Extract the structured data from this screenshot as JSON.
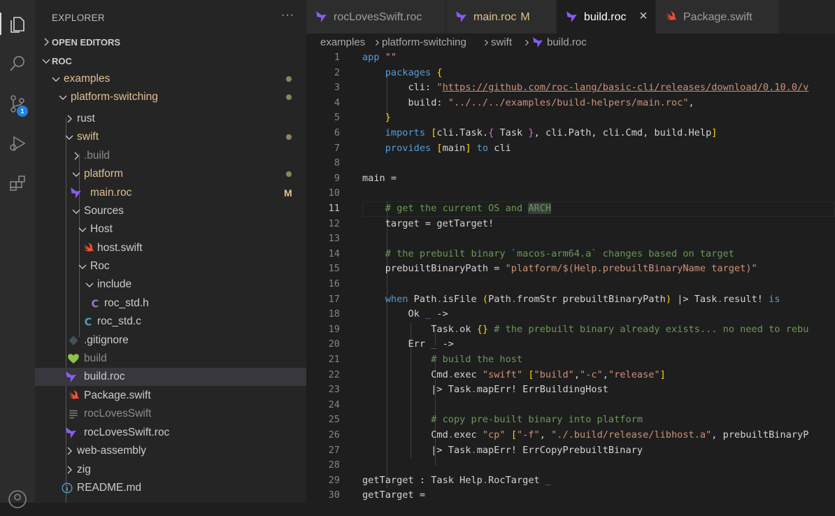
{
  "sidebar": {
    "title": "EXPLORER",
    "more": "···",
    "open_editors": "OPEN EDITORS",
    "root": "ROC",
    "tree": [
      {
        "label": "examples",
        "icon": "chevron-down",
        "status": "dot",
        "color": "#e2c08d"
      },
      {
        "label": "platform-switching",
        "icon": "chevron-down",
        "status": "dot",
        "color": "#e2c08d"
      },
      {
        "label": "rust",
        "icon": "chevron-right",
        "color": "#cccccc"
      },
      {
        "label": "swift",
        "icon": "chevron-down",
        "status": "dot",
        "color": "#e2c08d"
      },
      {
        "label": ".build",
        "icon": "chevron-right",
        "color": "#8c8c8c"
      },
      {
        "label": "platform",
        "icon": "chevron-down",
        "status": "dot",
        "color": "#e2c08d"
      },
      {
        "label": "main.roc",
        "icon": "roc-file-icon",
        "status": "M",
        "color": "#e2c08d"
      },
      {
        "label": "Sources",
        "icon": "chevron-down",
        "color": "#cccccc"
      },
      {
        "label": "Host",
        "icon": "chevron-down",
        "color": "#cccccc"
      },
      {
        "label": "host.swift",
        "icon": "swift-file-icon",
        "color": "#cccccc"
      },
      {
        "label": "Roc",
        "icon": "chevron-down",
        "color": "#cccccc"
      },
      {
        "label": "include",
        "icon": "chevron-down",
        "color": "#cccccc"
      },
      {
        "label": "roc_std.h",
        "icon": "c-header-icon",
        "color": "#cccccc"
      },
      {
        "label": "roc_std.c",
        "icon": "c-file-icon",
        "color": "#cccccc"
      },
      {
        "label": ".gitignore",
        "icon": "git-icon",
        "color": "#cccccc"
      },
      {
        "label": "build",
        "icon": "heart-icon",
        "color": "#8c8c8c"
      },
      {
        "label": "build.roc",
        "icon": "roc-file-icon",
        "color": "#cccccc",
        "selected": true
      },
      {
        "label": "Package.swift",
        "icon": "swift-file-icon",
        "color": "#cccccc"
      },
      {
        "label": "rocLovesSwift",
        "icon": "lines-icon",
        "color": "#8c8c8c"
      },
      {
        "label": "rocLovesSwift.roc",
        "icon": "roc-file-icon",
        "color": "#cccccc"
      },
      {
        "label": "web-assembly",
        "icon": "chevron-right",
        "color": "#cccccc"
      },
      {
        "label": "zig",
        "icon": "chevron-right",
        "color": "#cccccc"
      },
      {
        "label": "README.md",
        "icon": "info-icon",
        "color": "#cccccc"
      }
    ]
  },
  "activity": {
    "scm_badge": "1"
  },
  "tabs": [
    {
      "label": "rocLovesSwift.roc",
      "icon": "roc-file-icon"
    },
    {
      "label": "main.roc",
      "suffix": "M",
      "icon": "roc-file-icon",
      "modified": true
    },
    {
      "label": "build.roc",
      "icon": "roc-file-icon",
      "active": true,
      "close": "×"
    },
    {
      "label": "Package.swift",
      "icon": "swift-file-icon"
    }
  ],
  "breadcrumb": [
    "examples",
    "platform-switching",
    "swift",
    "build.roc"
  ],
  "editor": {
    "current_line": 11,
    "lines": [
      {
        "n": 1,
        "tokens": [
          [
            "kw",
            "app"
          ],
          [
            "tx",
            " "
          ],
          [
            "str",
            "\"\""
          ]
        ]
      },
      {
        "n": 2,
        "tokens": [
          [
            "tx",
            "    "
          ],
          [
            "kw",
            "packages"
          ],
          [
            "tx",
            " "
          ],
          [
            "br",
            "{"
          ]
        ]
      },
      {
        "n": 3,
        "tokens": [
          [
            "tx",
            "        cli: "
          ],
          [
            "str",
            "\""
          ],
          [
            "url",
            "https://github.com/roc-lang/basic-cli/releases/download/0.10.0/v"
          ]
        ]
      },
      {
        "n": 4,
        "tokens": [
          [
            "tx",
            "        build: "
          ],
          [
            "str",
            "\"../../../examples/build-helpers/main.roc\""
          ],
          [
            "tx",
            ","
          ]
        ]
      },
      {
        "n": 5,
        "tokens": [
          [
            "tx",
            "    "
          ],
          [
            "br",
            "}"
          ]
        ]
      },
      {
        "n": 6,
        "tokens": [
          [
            "tx",
            "    "
          ],
          [
            "kw",
            "imports"
          ],
          [
            "tx",
            " "
          ],
          [
            "br",
            "["
          ],
          [
            "tx",
            "cli.Task."
          ],
          [
            "br2",
            "{"
          ],
          [
            "tx",
            " Task "
          ],
          [
            "br2",
            "}"
          ],
          [
            "tx",
            ", cli.Path, cli.Cmd, build.Help"
          ],
          [
            "br",
            "]"
          ]
        ]
      },
      {
        "n": 7,
        "tokens": [
          [
            "tx",
            "    "
          ],
          [
            "kw",
            "provides"
          ],
          [
            "tx",
            " "
          ],
          [
            "br",
            "["
          ],
          [
            "tx",
            "main"
          ],
          [
            "br",
            "]"
          ],
          [
            "tx",
            " "
          ],
          [
            "kw",
            "to"
          ],
          [
            "tx",
            " cli"
          ]
        ]
      },
      {
        "n": 8,
        "tokens": []
      },
      {
        "n": 9,
        "tokens": [
          [
            "tx",
            "main ="
          ]
        ]
      },
      {
        "n": 10,
        "tokens": []
      },
      {
        "n": 11,
        "tokens": [
          [
            "tx",
            "    "
          ],
          [
            "cm",
            "# get the current OS and "
          ],
          [
            "hl",
            "ARCH"
          ]
        ]
      },
      {
        "n": 12,
        "tokens": [
          [
            "tx",
            "    target = getTarget!"
          ]
        ]
      },
      {
        "n": 13,
        "tokens": []
      },
      {
        "n": 14,
        "tokens": [
          [
            "tx",
            "    "
          ],
          [
            "cm",
            "# the prebuilt binary `macos-arm64.a` changes based on target"
          ]
        ]
      },
      {
        "n": 15,
        "tokens": [
          [
            "tx",
            "    prebuiltBinaryPath = "
          ],
          [
            "str",
            "\"platform/$(Help.prebuiltBinaryName target)\""
          ]
        ]
      },
      {
        "n": 16,
        "tokens": []
      },
      {
        "n": 17,
        "tokens": [
          [
            "tx",
            "    "
          ],
          [
            "kw",
            "when"
          ],
          [
            "tx",
            " Path"
          ],
          [
            "kw",
            "."
          ],
          [
            "tx",
            "isFile "
          ],
          [
            "br",
            "("
          ],
          [
            "tx",
            "Path"
          ],
          [
            "kw",
            "."
          ],
          [
            "tx",
            "fromStr prebuiltBinaryPath"
          ],
          [
            "br",
            ")"
          ],
          [
            "tx",
            " |> Task"
          ],
          [
            "kw",
            "."
          ],
          [
            "tx",
            "result! "
          ],
          [
            "kw",
            "is"
          ]
        ]
      },
      {
        "n": 18,
        "tokens": [
          [
            "tx",
            "        Ok "
          ],
          [
            "kw",
            "_"
          ],
          [
            "tx",
            " ->"
          ]
        ]
      },
      {
        "n": 19,
        "tokens": [
          [
            "tx",
            "            Task"
          ],
          [
            "kw",
            "."
          ],
          [
            "tx",
            "ok "
          ],
          [
            "br",
            "{}"
          ],
          [
            "tx",
            " "
          ],
          [
            "cm",
            "# the prebuilt binary already exists... no need to rebu"
          ]
        ]
      },
      {
        "n": 20,
        "tokens": [
          [
            "tx",
            "        Err "
          ],
          [
            "kw",
            "_"
          ],
          [
            "tx",
            " ->"
          ]
        ]
      },
      {
        "n": 21,
        "tokens": [
          [
            "tx",
            "            "
          ],
          [
            "cm",
            "# build the host"
          ]
        ]
      },
      {
        "n": 22,
        "tokens": [
          [
            "tx",
            "            Cmd"
          ],
          [
            "kw",
            "."
          ],
          [
            "tx",
            "exec "
          ],
          [
            "str",
            "\"swift\""
          ],
          [
            "tx",
            " "
          ],
          [
            "br",
            "["
          ],
          [
            "str",
            "\"build\""
          ],
          [
            "tx",
            ","
          ],
          [
            "str",
            "\"-c\""
          ],
          [
            "tx",
            ","
          ],
          [
            "str",
            "\"release\""
          ],
          [
            "br",
            "]"
          ]
        ]
      },
      {
        "n": 23,
        "tokens": [
          [
            "tx",
            "            |> Task"
          ],
          [
            "kw",
            "."
          ],
          [
            "tx",
            "mapErr! ErrBuildingHost"
          ]
        ]
      },
      {
        "n": 24,
        "tokens": []
      },
      {
        "n": 25,
        "tokens": [
          [
            "tx",
            "            "
          ],
          [
            "cm",
            "# copy pre-built binary into platform"
          ]
        ]
      },
      {
        "n": 26,
        "tokens": [
          [
            "tx",
            "            Cmd"
          ],
          [
            "kw",
            "."
          ],
          [
            "tx",
            "exec "
          ],
          [
            "str",
            "\"cp\""
          ],
          [
            "tx",
            " "
          ],
          [
            "br",
            "["
          ],
          [
            "str",
            "\"-f\""
          ],
          [
            "tx",
            ", "
          ],
          [
            "str",
            "\"./.build/release/libhost.a\""
          ],
          [
            "tx",
            ", prebuiltBinaryP"
          ]
        ]
      },
      {
        "n": 27,
        "tokens": [
          [
            "tx",
            "            |> Task"
          ],
          [
            "kw",
            "."
          ],
          [
            "tx",
            "mapErr! ErrCopyPrebuiltBinary"
          ]
        ]
      },
      {
        "n": 28,
        "tokens": []
      },
      {
        "n": 29,
        "tokens": [
          [
            "tx",
            "getTarget : Task Help"
          ],
          [
            "kw",
            "."
          ],
          [
            "tx",
            "RocTarget "
          ],
          [
            "kw",
            "_"
          ]
        ]
      },
      {
        "n": 30,
        "tokens": [
          [
            "tx",
            "getTarget ="
          ]
        ]
      }
    ]
  }
}
